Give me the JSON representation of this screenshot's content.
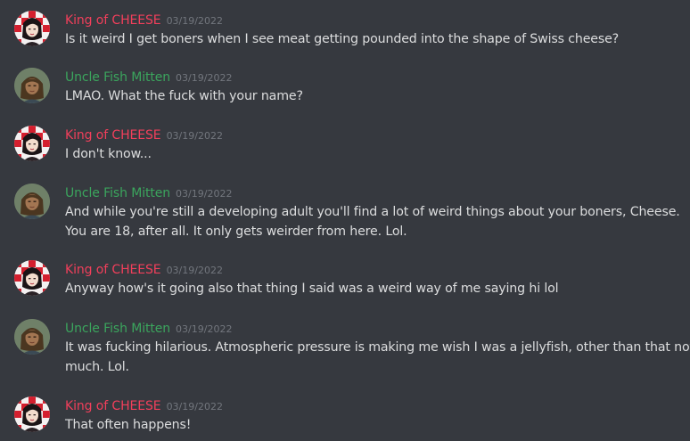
{
  "users": {
    "king": {
      "name": "King of CHEESE",
      "color": "#f23f5b",
      "avatar_icon": "king-of-cheese-avatar-icon"
    },
    "fish": {
      "name": "Uncle Fish Mitten",
      "color": "#3ba55d",
      "avatar_icon": "uncle-fish-mitten-avatar-icon"
    }
  },
  "messages": [
    {
      "author": "King of CHEESE",
      "timestamp": "03/19/2022",
      "lines": [
        "Is it weird I get boners when I see meat getting pounded into the shape of Swiss cheese?"
      ]
    },
    {
      "author": "Uncle Fish Mitten",
      "timestamp": "03/19/2022",
      "lines": [
        "LMAO. What the fuck with your name?"
      ]
    },
    {
      "author": "King of CHEESE",
      "timestamp": "03/19/2022",
      "lines": [
        "I don't know..."
      ]
    },
    {
      "author": "Uncle Fish Mitten",
      "timestamp": "03/19/2022",
      "lines": [
        "And while you're still a developing adult you'll find a lot of weird things about your boners, Cheese.",
        "You are 18, after all. It only gets weirder from here. Lol."
      ]
    },
    {
      "author": "King of CHEESE",
      "timestamp": "03/19/2022",
      "lines": [
        "Anyway how's it going also that thing I said was a weird way of me saying hi lol"
      ]
    },
    {
      "author": "Uncle Fish Mitten",
      "timestamp": "03/19/2022",
      "lines": [
        "It was fucking hilarious. Atmospheric pressure is making me wish I was a jellyfish, other than that not",
        "much. Lol."
      ]
    },
    {
      "author": "King of CHEESE",
      "timestamp": "03/19/2022",
      "lines": [
        "That often happens!"
      ]
    }
  ]
}
